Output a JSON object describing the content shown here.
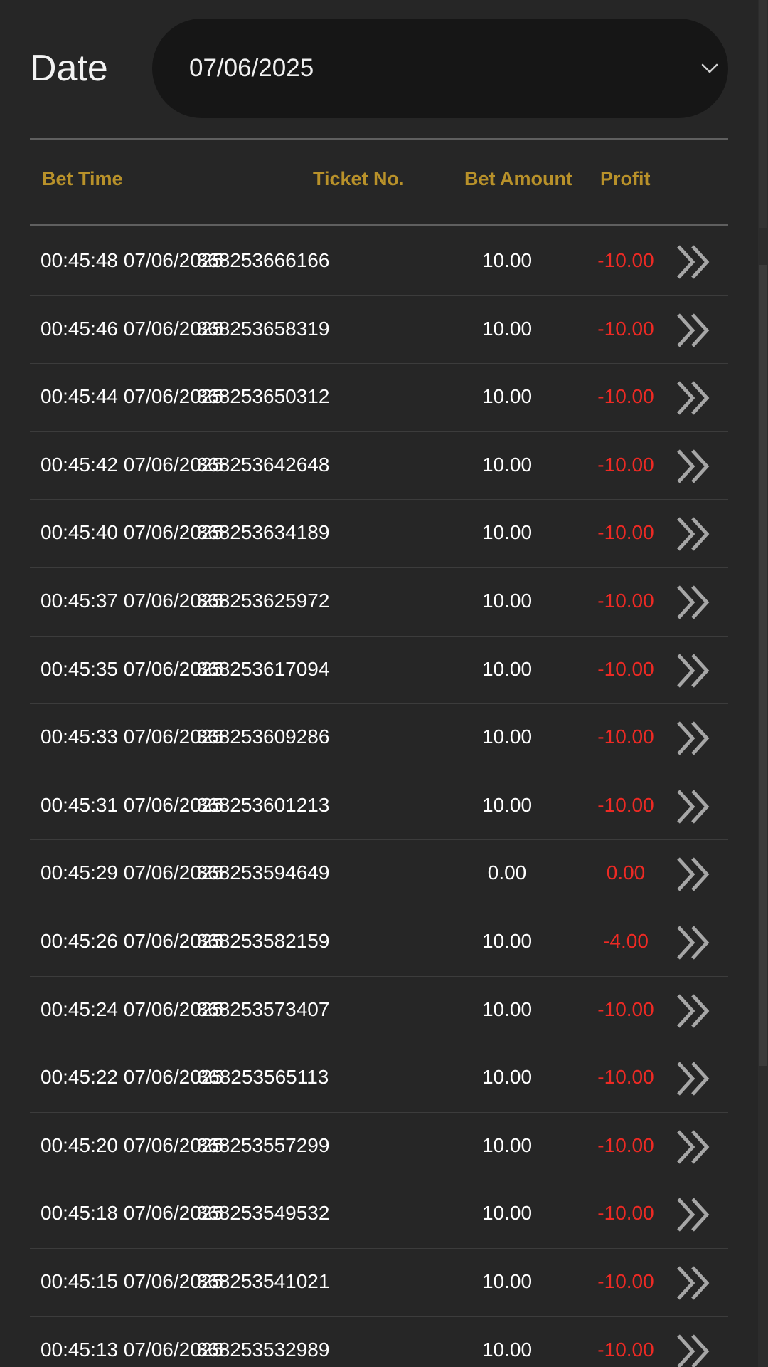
{
  "filter": {
    "date_label": "Date",
    "date_value": "07/06/2025"
  },
  "table": {
    "headers": {
      "bet_time": "Bet Time",
      "ticket_no": "Ticket No.",
      "bet_amount": "Bet Amount",
      "profit": "Profit"
    },
    "rows": [
      {
        "time": "00:45:48 07/06/2025",
        "ticket": "368253666166",
        "amount": "10.00",
        "profit": "-10.00"
      },
      {
        "time": "00:45:46 07/06/2025",
        "ticket": "368253658319",
        "amount": "10.00",
        "profit": "-10.00"
      },
      {
        "time": "00:45:44 07/06/2025",
        "ticket": "368253650312",
        "amount": "10.00",
        "profit": "-10.00"
      },
      {
        "time": "00:45:42 07/06/2025",
        "ticket": "368253642648",
        "amount": "10.00",
        "profit": "-10.00"
      },
      {
        "time": "00:45:40 07/06/2025",
        "ticket": "368253634189",
        "amount": "10.00",
        "profit": "-10.00"
      },
      {
        "time": "00:45:37 07/06/2025",
        "ticket": "368253625972",
        "amount": "10.00",
        "profit": "-10.00"
      },
      {
        "time": "00:45:35 07/06/2025",
        "ticket": "368253617094",
        "amount": "10.00",
        "profit": "-10.00"
      },
      {
        "time": "00:45:33 07/06/2025",
        "ticket": "368253609286",
        "amount": "10.00",
        "profit": "-10.00"
      },
      {
        "time": "00:45:31 07/06/2025",
        "ticket": "368253601213",
        "amount": "10.00",
        "profit": "-10.00"
      },
      {
        "time": "00:45:29 07/06/2025",
        "ticket": "368253594649",
        "amount": "0.00",
        "profit": "0.00"
      },
      {
        "time": "00:45:26 07/06/2025",
        "ticket": "368253582159",
        "amount": "10.00",
        "profit": "-4.00"
      },
      {
        "time": "00:45:24 07/06/2025",
        "ticket": "368253573407",
        "amount": "10.00",
        "profit": "-10.00"
      },
      {
        "time": "00:45:22 07/06/2025",
        "ticket": "368253565113",
        "amount": "10.00",
        "profit": "-10.00"
      },
      {
        "time": "00:45:20 07/06/2025",
        "ticket": "368253557299",
        "amount": "10.00",
        "profit": "-10.00"
      },
      {
        "time": "00:45:18 07/06/2025",
        "ticket": "368253549532",
        "amount": "10.00",
        "profit": "-10.00"
      },
      {
        "time": "00:45:15 07/06/2025",
        "ticket": "368253541021",
        "amount": "10.00",
        "profit": "-10.00"
      },
      {
        "time": "00:45:13 07/06/2025",
        "ticket": "368253532989",
        "amount": "10.00",
        "profit": "-10.00"
      }
    ]
  },
  "icons": {
    "dropdown": "chevron-down-icon",
    "row_detail": "double-chevron-right-icon"
  },
  "colors": {
    "background": "#262626",
    "select_background": "#161616",
    "header_text": "#b8912a",
    "profit_negative": "#ee2a24",
    "icon_gray": "#a6a6a6"
  }
}
